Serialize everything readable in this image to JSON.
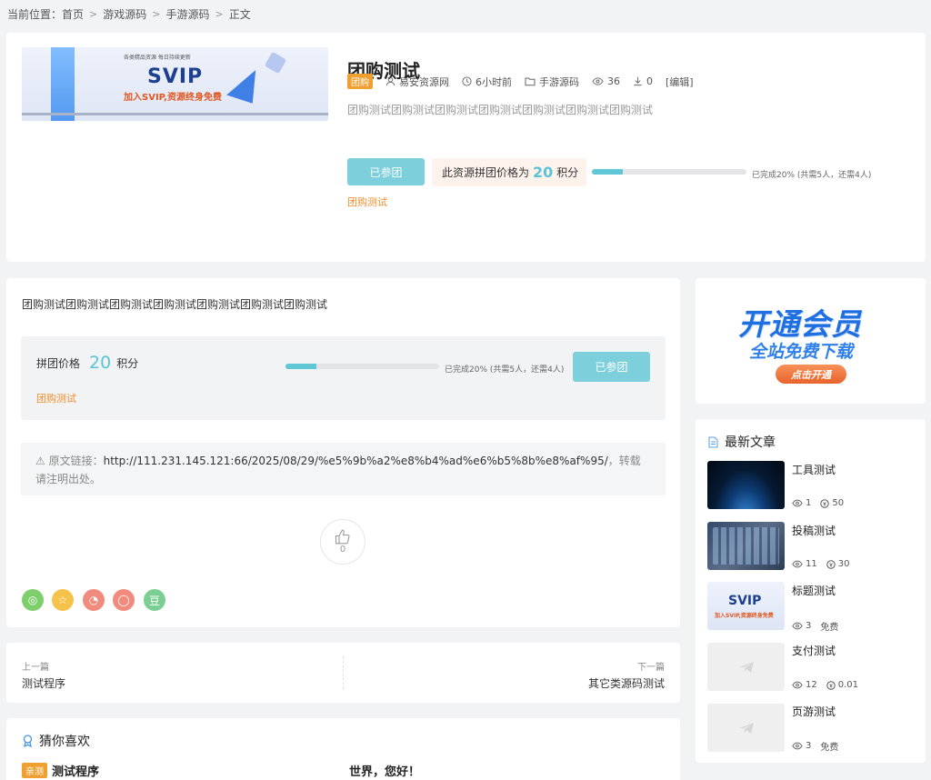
{
  "breadcrumb": {
    "prefix": "当前位置：",
    "items": [
      "首页",
      "游戏源码",
      "手游源码",
      "正文"
    ]
  },
  "post": {
    "title": "团购测试",
    "tag": "团购",
    "author": "易安资源网",
    "time": "6小时前",
    "category": "手游源码",
    "views": "36",
    "downloads": "0",
    "edit": "[编辑]",
    "excerpt": "团购测试团购测试团购测试团购测试团购测试团购测试团购测试",
    "banner": {
      "line1": "各类精品资源  每日持续更新",
      "brand": "SVIP",
      "line2": "加入SVIP,资源终身免费"
    }
  },
  "group_buy": {
    "joined_label": "已参团",
    "price_prefix": "此资源拼团价格为",
    "price": "20",
    "unit": "积分",
    "progress_fraction": 0.2,
    "progress_text": "已完成20% (共需5人，还需4人)",
    "link_label": "团购测试",
    "box_label": "拼团价格"
  },
  "content": {
    "body": "团购测试团购测试团购测试团购测试团购测试团购测试团购测试",
    "source_label": "原文链接：",
    "source_url": "http://111.231.145.121:66/2025/08/29/%e5%9b%a2%e8%b4%ad%e6%b5%8b%e8%af%95/",
    "source_suffix": "，转载请注明出处。",
    "likes": "0",
    "share": [
      {
        "name": "wechat",
        "color": "#7ccf6a",
        "glyph": "◎"
      },
      {
        "name": "qzone",
        "color": "#f5c24a",
        "glyph": "☆"
      },
      {
        "name": "weibo",
        "color": "#f08b7e",
        "glyph": "◔"
      },
      {
        "name": "qq",
        "color": "#f08b7e",
        "glyph": "◯"
      },
      {
        "name": "douban",
        "color": "#7ccf93",
        "glyph": "豆"
      }
    ]
  },
  "nav": {
    "prev_label": "上一篇",
    "prev_title": "测试程序",
    "next_label": "下一篇",
    "next_title": "其它类源码测试"
  },
  "related": {
    "heading": "猜你喜欢",
    "badge": "亲测",
    "item1": "测试程序",
    "item2": "世界，您好！"
  },
  "sidebar": {
    "vip_line1": "开通会员",
    "vip_line2": "全站免费下载",
    "vip_button": "点击开通",
    "latest_heading": "最新文章",
    "articles": [
      {
        "title": "工具测试",
        "views": "1",
        "price": "50"
      },
      {
        "title": "投稿测试",
        "views": "11",
        "price": "30"
      },
      {
        "title": "标题测试",
        "views": "3",
        "price": "免费"
      },
      {
        "title": "支付测试",
        "views": "12",
        "price": "0.01"
      },
      {
        "title": "页游测试",
        "views": "3",
        "price": "免费"
      }
    ]
  }
}
